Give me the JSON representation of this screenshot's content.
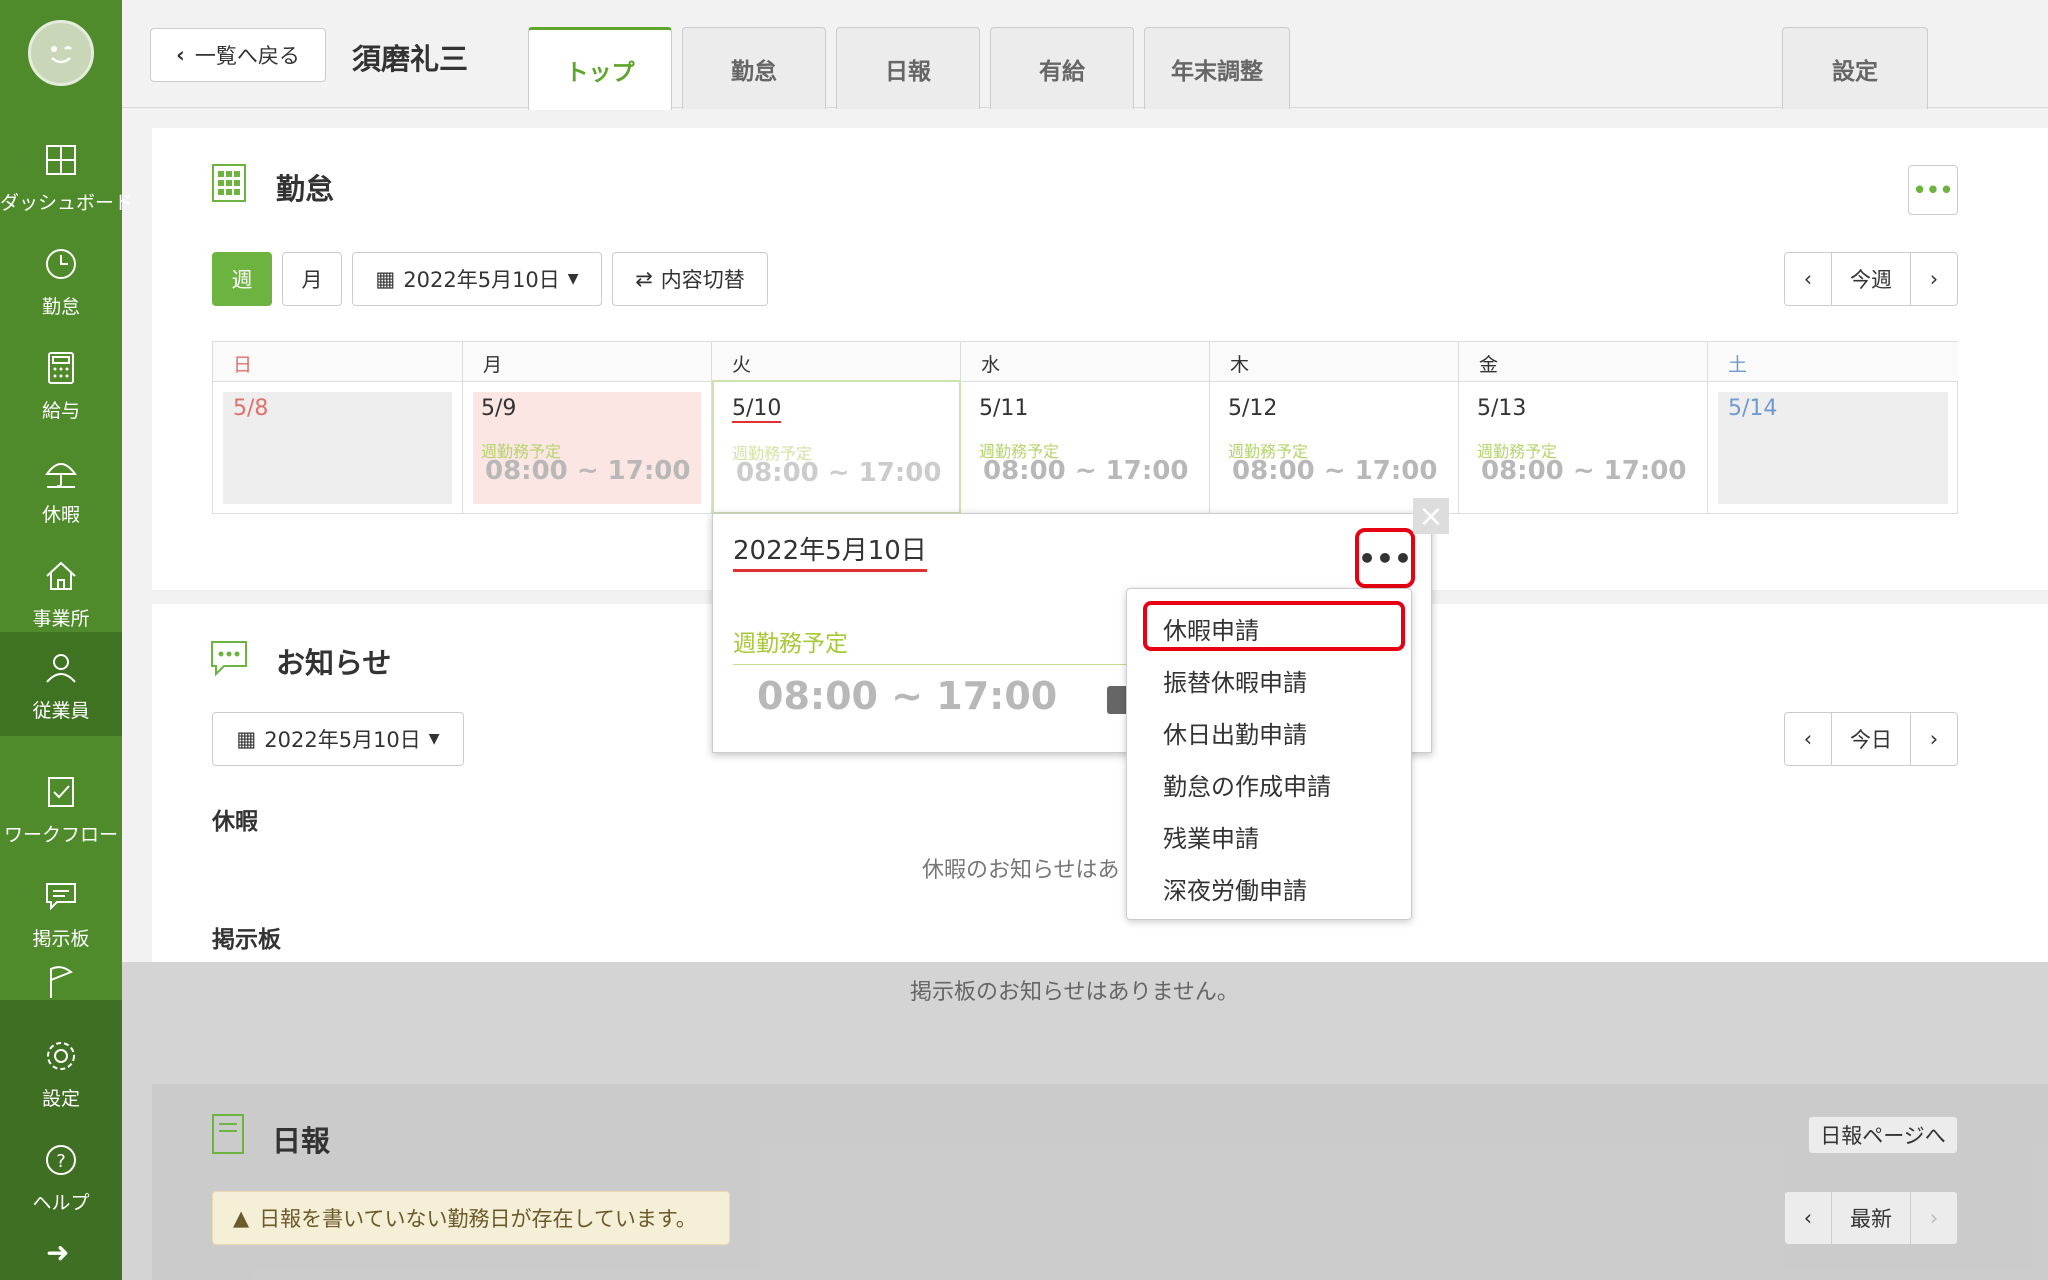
{
  "sidebar": {
    "items": [
      {
        "label": "ダッシュボード"
      },
      {
        "label": "勤怠"
      },
      {
        "label": "給与"
      },
      {
        "label": "休暇"
      },
      {
        "label": "事業所"
      },
      {
        "label": "従業員"
      },
      {
        "label": "ワークフロー"
      },
      {
        "label": "掲示板"
      },
      {
        "label": "設定"
      },
      {
        "label": "ヘルプ"
      }
    ],
    "expand_icon": "arrow-right-icon"
  },
  "header": {
    "back_label": "一覧へ戻る",
    "employee_name": "須磨礼三",
    "tabs": [
      {
        "label": "トップ"
      },
      {
        "label": "勤怠"
      },
      {
        "label": "日報"
      },
      {
        "label": "有給"
      },
      {
        "label": "年末調整"
      }
    ],
    "settings_tab": "設定"
  },
  "attendance": {
    "title": "勤怠",
    "more_label": "•••",
    "view_week": "週",
    "view_month": "月",
    "date_select": "2022年5月10日",
    "switch_label": "内容切替",
    "nav_prev": "‹",
    "nav_current": "今週",
    "nav_next": "›",
    "days": [
      {
        "head": "日",
        "date": "5/8",
        "plan": "",
        "time": ""
      },
      {
        "head": "月",
        "date": "5/9",
        "plan": "週勤務予定",
        "time": "08:00 ~ 17:00"
      },
      {
        "head": "火",
        "date": "5/10",
        "plan": "週勤務予定",
        "time": "08:00 ~ 17:00"
      },
      {
        "head": "水",
        "date": "5/11",
        "plan": "週勤務予定",
        "time": "08:00 ~ 17:00"
      },
      {
        "head": "木",
        "date": "5/12",
        "plan": "週勤務予定",
        "time": "08:00 ~ 17:00"
      },
      {
        "head": "金",
        "date": "5/13",
        "plan": "週勤務予定",
        "time": "08:00 ~ 17:00"
      },
      {
        "head": "土",
        "date": "5/14",
        "plan": "",
        "time": ""
      }
    ],
    "colors": {
      "sunday": "#e0706a",
      "saturday": "#6f9ad0",
      "accent": "#6db33f"
    }
  },
  "popover": {
    "date": "2022年5月10日",
    "more": "•••",
    "plan": "週勤務予定",
    "time": "08:00 ~ 17:00",
    "close": "×",
    "menu": [
      "休暇申請",
      "振替休暇申請",
      "休日出勤申請",
      "勤怠の作成申請",
      "残業申請",
      "深夜労働申請"
    ]
  },
  "notices": {
    "title": "お知らせ",
    "date_select": "2022年5月10日",
    "nav_prev": "‹",
    "nav_current": "今日",
    "nav_next": "›",
    "leave_label": "休暇",
    "leave_empty": "休暇のお知らせはあ",
    "board_label": "掲示板",
    "board_empty": "掲示板のお知らせはありません。"
  },
  "daily_report": {
    "title": "日報",
    "page_link": "日報ページへ",
    "warning": "日報を書いていない勤務日が存在しています。",
    "nav_prev": "‹",
    "nav_current": "最新",
    "nav_next": "›"
  }
}
